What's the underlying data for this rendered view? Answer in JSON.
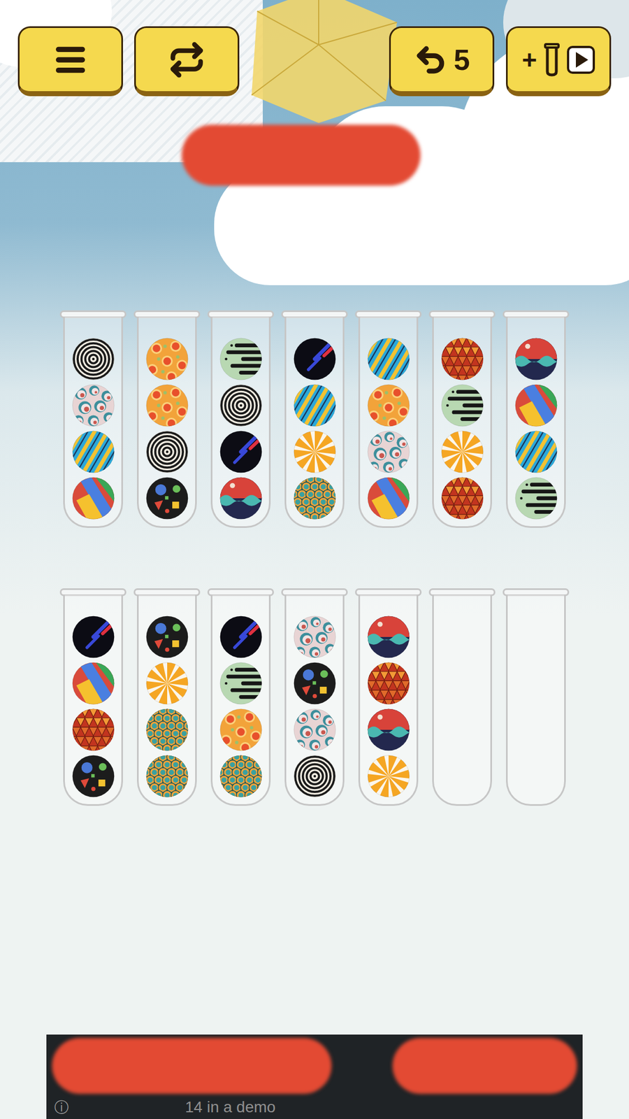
{
  "toolbar": {
    "undo_count": "5",
    "add_tube_label": "+"
  },
  "tubes": [
    {
      "balls": [
        {
          "kind": "rings"
        },
        {
          "kind": "bubbles"
        },
        {
          "kind": "stripes"
        },
        {
          "kind": "google"
        }
      ]
    },
    {
      "balls": [
        {
          "kind": "citrus"
        },
        {
          "kind": "citrus"
        },
        {
          "kind": "rings"
        },
        {
          "kind": "confetti"
        }
      ]
    },
    {
      "balls": [
        {
          "kind": "lines"
        },
        {
          "kind": "rings"
        },
        {
          "kind": "meteor"
        },
        {
          "kind": "waves"
        }
      ]
    },
    {
      "balls": [
        {
          "kind": "meteor"
        },
        {
          "kind": "stripes"
        },
        {
          "kind": "swirl"
        },
        {
          "kind": "scales"
        }
      ]
    },
    {
      "balls": [
        {
          "kind": "stripes"
        },
        {
          "kind": "citrus"
        },
        {
          "kind": "bubbles"
        },
        {
          "kind": "google"
        }
      ]
    },
    {
      "balls": [
        {
          "kind": "diamonds"
        },
        {
          "kind": "lines"
        },
        {
          "kind": "swirl"
        },
        {
          "kind": "diamonds"
        }
      ]
    },
    {
      "balls": [
        {
          "kind": "waves"
        },
        {
          "kind": "google"
        },
        {
          "kind": "stripes"
        },
        {
          "kind": "lines"
        }
      ]
    },
    {
      "balls": [
        {
          "kind": "meteor"
        },
        {
          "kind": "google"
        },
        {
          "kind": "diamonds"
        },
        {
          "kind": "confetti"
        }
      ]
    },
    {
      "balls": [
        {
          "kind": "confetti"
        },
        {
          "kind": "swirl"
        },
        {
          "kind": "scales"
        },
        {
          "kind": "scales"
        }
      ]
    },
    {
      "balls": [
        {
          "kind": "meteor"
        },
        {
          "kind": "lines"
        },
        {
          "kind": "citrus"
        },
        {
          "kind": "scales"
        }
      ]
    },
    {
      "balls": [
        {
          "kind": "bubbles"
        },
        {
          "kind": "confetti"
        },
        {
          "kind": "bubbles"
        },
        {
          "kind": "rings"
        }
      ]
    },
    {
      "balls": [
        {
          "kind": "waves"
        },
        {
          "kind": "diamonds"
        },
        {
          "kind": "waves"
        },
        {
          "kind": "swirl"
        }
      ]
    },
    {
      "balls": []
    },
    {
      "balls": []
    }
  ],
  "ad": {
    "info": "ⓘ",
    "text": "14 in a demo"
  }
}
